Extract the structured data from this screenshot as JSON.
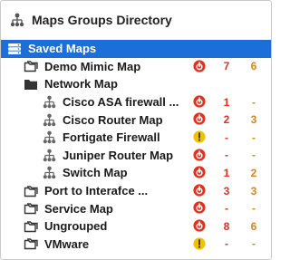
{
  "header": {
    "title": "Maps Groups Directory",
    "icon": "hierarchy-icon"
  },
  "colors": {
    "selection": "#1c6fd8",
    "critical": "#e5301e",
    "warning": "#f2c200",
    "minor": "#e8820c"
  },
  "rows": [
    {
      "label": "Saved Maps",
      "icon": "database-icon",
      "level": 0,
      "selected": true,
      "status": "",
      "critical": "",
      "minor": ""
    },
    {
      "label": "Demo Mimic Map",
      "icon": "folder-icon",
      "level": 1,
      "status": "critical",
      "critical": "7",
      "minor": "6"
    },
    {
      "label": "Network Map",
      "icon": "folder-filled-icon",
      "level": 1,
      "status": "",
      "critical": "",
      "minor": ""
    },
    {
      "label": "Cisco ASA firewall ...",
      "icon": "hierarchy-icon",
      "level": 2,
      "status": "critical",
      "critical": "1",
      "minor": "-"
    },
    {
      "label": "Cisco Router Map",
      "icon": "hierarchy-icon",
      "level": 2,
      "status": "critical",
      "critical": "2",
      "minor": "3"
    },
    {
      "label": "Fortigate Firewall",
      "icon": "hierarchy-icon",
      "level": 2,
      "status": "warning",
      "critical": "-",
      "minor": "-"
    },
    {
      "label": "Juniper Router Map",
      "icon": "hierarchy-icon",
      "level": 2,
      "status": "critical",
      "critical": "-",
      "minor": "-"
    },
    {
      "label": "Switch Map",
      "icon": "hierarchy-icon",
      "level": 2,
      "status": "critical",
      "critical": "1",
      "minor": "2"
    },
    {
      "label": "Port to Interafce ...",
      "icon": "folder-icon",
      "level": 1,
      "status": "critical",
      "critical": "3",
      "minor": "3"
    },
    {
      "label": "Service Map",
      "icon": "folder-icon",
      "level": 1,
      "status": "critical",
      "critical": "-",
      "minor": "-"
    },
    {
      "label": "Ungrouped",
      "icon": "folder-icon",
      "level": 1,
      "status": "critical",
      "critical": "8",
      "minor": "6"
    },
    {
      "label": "VMware",
      "icon": "folder-icon",
      "level": 1,
      "status": "warning",
      "critical": "-",
      "minor": "-"
    }
  ]
}
